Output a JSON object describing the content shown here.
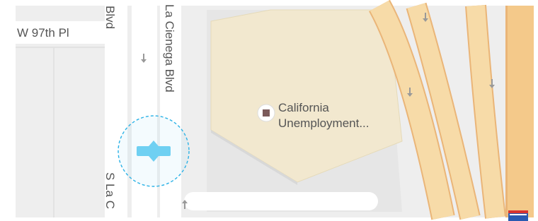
{
  "map": {
    "streets": {
      "w97th": "W 97th Pl",
      "blvd_top": "Blvd",
      "la_cienega": "La Cienega Blvd",
      "s_la_c": "S La C"
    },
    "poi": {
      "name_line1": "California",
      "name_line2": "Unemployment..."
    },
    "colors": {
      "land": "#eeeeee",
      "road": "#ffffff",
      "building": "#f2e8cf",
      "highway": "#f7dba8",
      "highway_edge": "#eab578",
      "location_dot": "#6fd0f2",
      "accuracy_ring": "#2bb2e6"
    },
    "icons": {
      "poi": "building-marker-icon",
      "location": "current-location-icon",
      "shield": "interstate-shield-icon",
      "arrows": "one-way-arrow-icon"
    }
  }
}
